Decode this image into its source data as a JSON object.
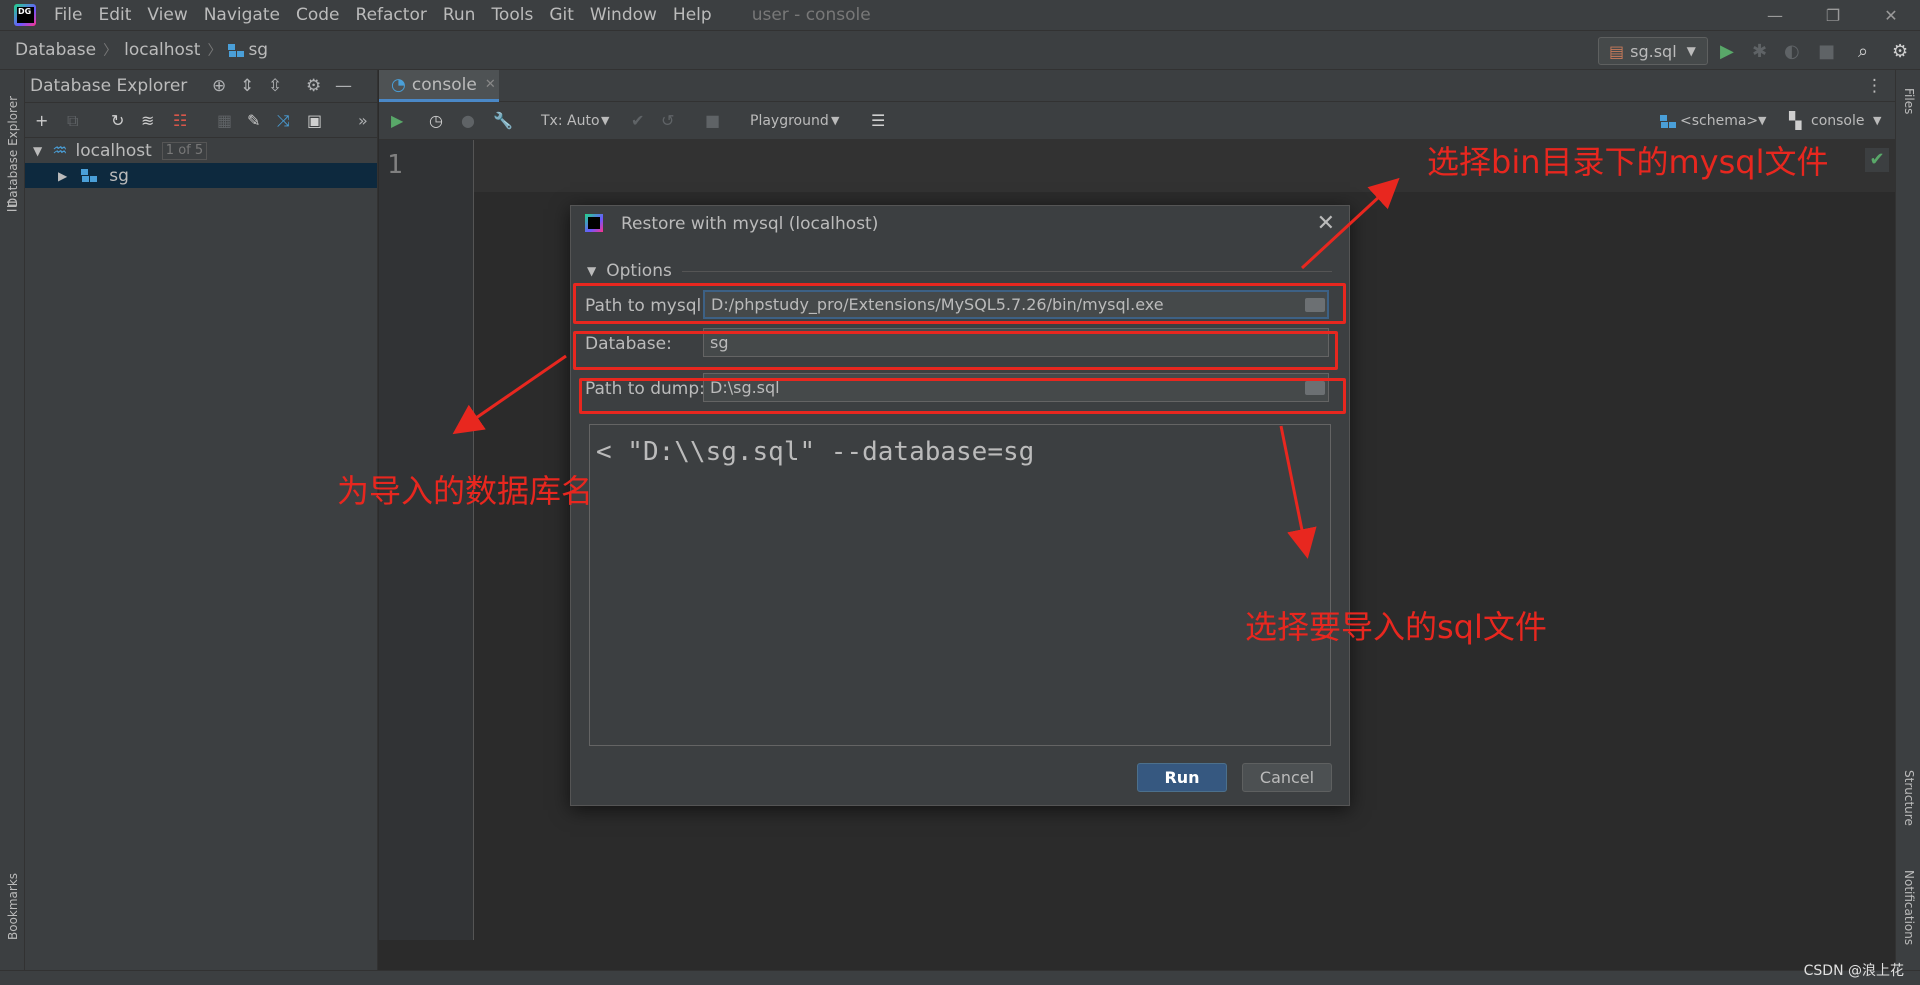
{
  "menu": {
    "items": [
      "File",
      "Edit",
      "View",
      "Navigate",
      "Code",
      "Refactor",
      "Run",
      "Tools",
      "Git",
      "Window",
      "Help"
    ],
    "window_title": "user - console"
  },
  "breadcrumb": {
    "items": [
      "Database",
      "localhost",
      "sg"
    ]
  },
  "run_config": {
    "label": "sg.sql"
  },
  "db_explorer": {
    "title": "Database Explorer",
    "tree": [
      {
        "label": "localhost",
        "badge": "1 of 5"
      },
      {
        "label": "sg"
      }
    ]
  },
  "editor": {
    "tab_label": "console",
    "toolbar": {
      "tx_mode": "Tx: Auto",
      "playground": "Playground",
      "schema": "<schema>",
      "console": "console"
    },
    "line_number": "1"
  },
  "side_tabs": {
    "left_top": "Database Explorer",
    "left_bottom": "Bookmarks",
    "right_top": "Files",
    "right_mid": "Structure",
    "right_bottom": "Notifications"
  },
  "dialog": {
    "title": "Restore with mysql (localhost)",
    "options_label": "Options",
    "path_mysql_label": "Path to mysql:",
    "path_mysql_value": "D:/phpstudy_pro/Extensions/MySQL5.7.26/bin/mysql.exe",
    "database_label": "Database:",
    "database_value": "sg",
    "path_dump_label": "Path to dump:",
    "path_dump_value": "D:\\sg.sql",
    "command_preview": "< \"D:\\\\sg.sql\" --database=sg",
    "run_label": "Run",
    "cancel_label": "Cancel"
  },
  "annotations": {
    "bin_mysql": "选择bin目录下的mysql文件",
    "db_name": "为导入的数据库名",
    "sql_file": "选择要导入的sql文件",
    "color": "#e8271f"
  },
  "watermark": "CSDN @浪上花"
}
